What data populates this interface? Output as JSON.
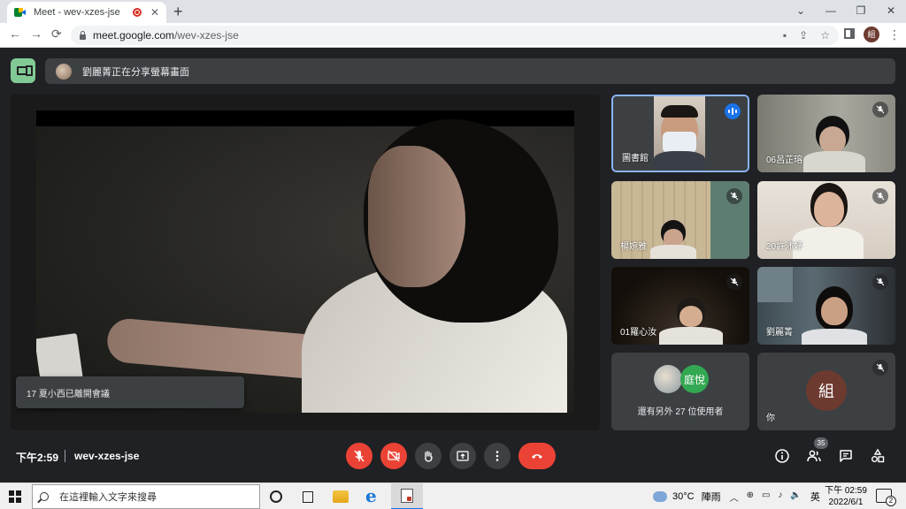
{
  "browser": {
    "tab_title": "Meet - wev-xzes-jse",
    "tab_close": "✕",
    "new_tab": "+",
    "window_controls": [
      "⌄",
      "—",
      "❐",
      "✕"
    ],
    "nav": {
      "back": "←",
      "forward": "→",
      "reload": "⟳"
    },
    "url_host": "meet.google.com",
    "url_path": "/wev-xzes-jse",
    "omnibox_icons": [
      "▪",
      "⇪",
      "☆"
    ],
    "profile_initial": "組",
    "menu": "⋮"
  },
  "meet": {
    "banner_text": "劉麗菁正在分享螢幕畫面",
    "toast_text": "17 夏小西已離開會議",
    "tiles": [
      {
        "name": "圖書館",
        "status": "speaking"
      },
      {
        "name": "06呂芷瑢",
        "status": "muted"
      },
      {
        "name": "楊婉雅",
        "status": "muted"
      },
      {
        "name": "20許沛妤",
        "status": "muted"
      },
      {
        "name": "01羅心汝",
        "status": "muted"
      },
      {
        "name": "劉麗菁",
        "status": "muted"
      }
    ],
    "others_avatar_label": "庭悅",
    "others_text": "還有另外 27 位使用者",
    "self_name": "你",
    "self_initial": "組",
    "clock": "下午2:59",
    "meeting_code": "wev-xzes-jse",
    "people_count": "35",
    "colors": {
      "accent": "#8ab4f8",
      "danger": "#ea4335",
      "speaking": "#1a73e8",
      "present_green": "#81c995"
    }
  },
  "taskbar": {
    "search_placeholder": "在這裡輸入文字來搜尋",
    "weather_temp": "30°C",
    "weather_desc": "陣雨",
    "tray_icons": [
      "︿",
      "⊕",
      "▭",
      "♪",
      "🔈"
    ],
    "ime": "英",
    "time": "下午 02:59",
    "date": "2022/6/1",
    "notification_count": "2"
  }
}
